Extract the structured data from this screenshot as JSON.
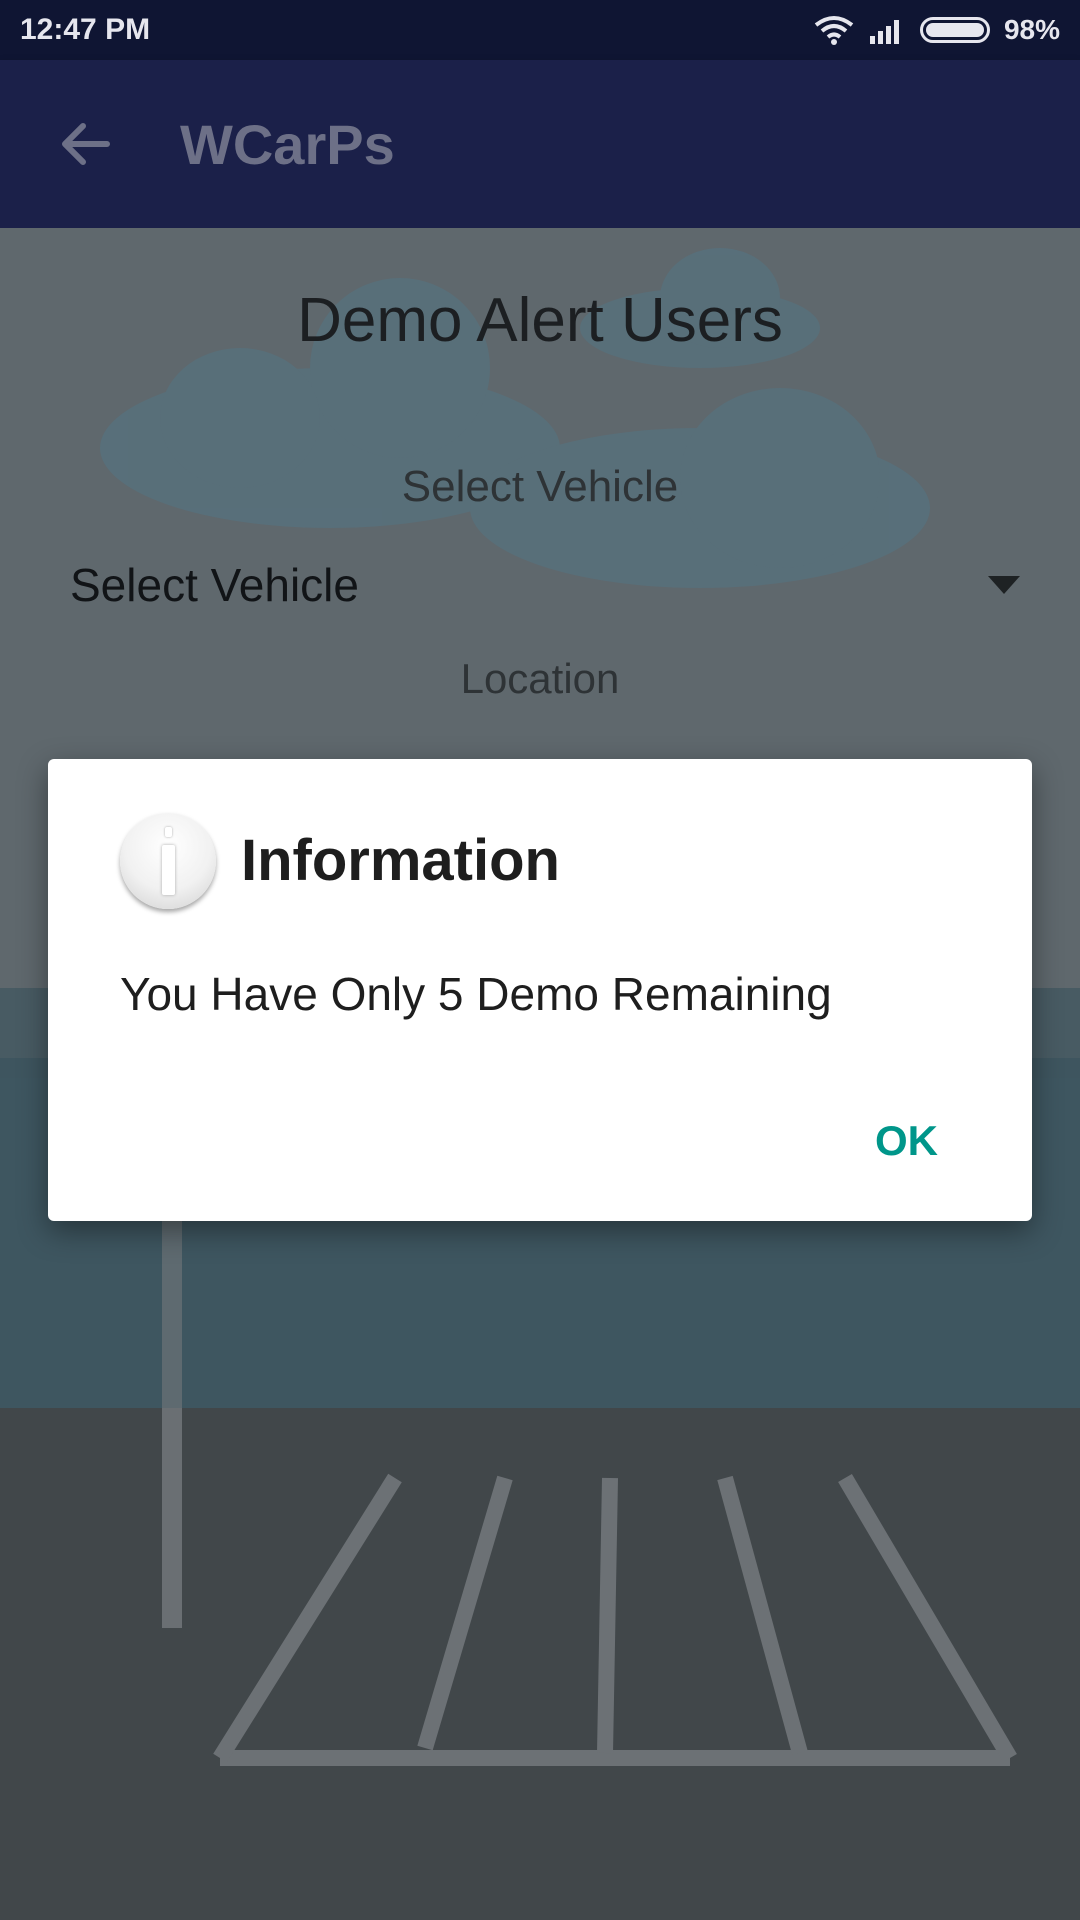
{
  "status_bar": {
    "time": "12:47 PM",
    "battery_percent": "98%",
    "icons": [
      "wifi-icon",
      "signal-icon",
      "battery-icon"
    ]
  },
  "app_bar": {
    "back_icon": "arrow-back-icon",
    "title": "WCarPs"
  },
  "form": {
    "heading": "Demo Alert Users",
    "vehicle_label": "Select Vehicle",
    "vehicle_value": "Select Vehicle",
    "location_label": "Location"
  },
  "dialog": {
    "icon": "info-icon",
    "title": "Information",
    "message": "You Have Only 5 Demo Remaining",
    "ok_label": "OK"
  },
  "colors": {
    "status_bar": "#0f1533",
    "app_bar": "#1b2049",
    "accent": "#00968a"
  }
}
